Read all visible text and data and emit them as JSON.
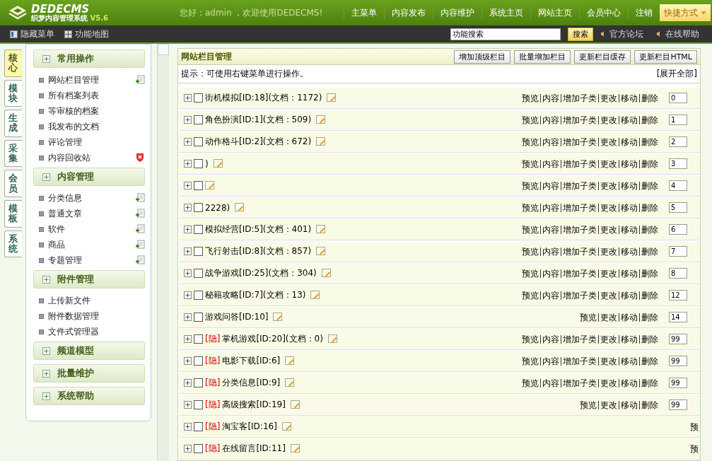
{
  "header": {
    "product": "DEDECMS",
    "subtitle": "织梦内容管理系统",
    "version": "V5.6",
    "greeting": "您好：admin ，欢迎使用DEDECMS!",
    "nav": [
      "主菜单",
      "内容发布",
      "内容维护",
      "系统主页",
      "网站主页",
      "会员中心",
      "注销"
    ],
    "quick": "快捷方式"
  },
  "toolbar": {
    "left": [
      "隐藏菜单",
      "功能地图"
    ],
    "search": {
      "value": "功能搜索"
    },
    "search_button": "搜索",
    "links": [
      "官方论坛",
      "在线帮助"
    ]
  },
  "side_tabs": [
    {
      "label": "核心",
      "selected": true
    },
    {
      "label": "模块",
      "selected": false
    },
    {
      "label": "生成",
      "selected": false
    },
    {
      "label": "采集",
      "selected": false
    },
    {
      "label": "会员",
      "selected": false
    },
    {
      "label": "模板",
      "selected": false
    },
    {
      "label": "系统",
      "selected": false
    }
  ],
  "sidebar": [
    {
      "title": "常用操作",
      "items": [
        {
          "label": "网站栏目管理",
          "kind": "add"
        },
        {
          "label": "所有档案列表",
          "kind": "plain"
        },
        {
          "label": "等审核的档案",
          "kind": "plain"
        },
        {
          "label": "我发布的文档",
          "kind": "plain"
        },
        {
          "label": "评论管理",
          "kind": "plain"
        },
        {
          "label": "内容回收站",
          "kind": "delete"
        }
      ]
    },
    {
      "title": "内容管理",
      "items": [
        {
          "label": "分类信息",
          "kind": "add"
        },
        {
          "label": "普通文章",
          "kind": "add"
        },
        {
          "label": "软件",
          "kind": "add"
        },
        {
          "label": "商品",
          "kind": "add"
        },
        {
          "label": "专题管理",
          "kind": "add"
        }
      ]
    },
    {
      "title": "附件管理",
      "items": [
        {
          "label": "上传新文件",
          "kind": "plain"
        },
        {
          "label": "附件数据管理",
          "kind": "plain"
        },
        {
          "label": "文件式管理器",
          "kind": "plain"
        }
      ]
    },
    {
      "title": "频道模型"
    },
    {
      "title": "批量维护"
    },
    {
      "title": "系统帮助"
    }
  ],
  "panel": {
    "title": "网站栏目管理",
    "buttons": [
      "增加顶级栏目",
      "批量增加栏目",
      "更新栏目缓存",
      "更新栏目HTML"
    ],
    "tip": "提示：可使用右键菜单进行操作。",
    "expand_all": "[展开全部]",
    "rows": [
      {
        "checked": false,
        "name": "街机模拟[ID:18](文档：1172)",
        "actions": [
          "预览",
          "内容",
          "增加子类",
          "更改",
          "移动",
          "删除"
        ],
        "order": "0"
      },
      {
        "checked": false,
        "name": "角色扮演[ID:1](文档：509)",
        "actions": [
          "预览",
          "内容",
          "增加子类",
          "更改",
          "移动",
          "删除"
        ],
        "order": "1"
      },
      {
        "checked": false,
        "name": "动作格斗[ID:2](文档：672)",
        "actions": [
          "预览",
          "内容",
          "增加子类",
          "更改",
          "移动",
          "删除"
        ],
        "order": "2"
      },
      {
        "checked": false,
        "name": ")",
        "actions": [
          "预览",
          "内容",
          "增加子类",
          "更改",
          "移动",
          "删除"
        ],
        "order": "3"
      },
      {
        "checked": false,
        "actions": [
          "预览",
          "内容",
          "增加子类",
          "更改",
          "移动",
          "删除"
        ],
        "order": "4"
      },
      {
        "checked": false,
        "name": "2228)",
        "actions": [
          "预览",
          "内容",
          "增加子类",
          "更改",
          "移动",
          "删除"
        ],
        "order": "5"
      },
      {
        "checked": false,
        "name": "模拟经营[ID:5](文档：401)",
        "actions": [
          "预览",
          "内容",
          "增加子类",
          "更改",
          "移动",
          "删除"
        ],
        "order": "6"
      },
      {
        "checked": false,
        "name": "飞行射击[ID:8](文档：857)",
        "actions": [
          "预览",
          "内容",
          "增加子类",
          "更改",
          "移动",
          "删除"
        ],
        "order": "7"
      },
      {
        "checked": false,
        "name": "战争游戏[ID:25](文档：304)",
        "actions": [
          "预览",
          "内容",
          "增加子类",
          "更改",
          "移动",
          "删除"
        ],
        "order": "8"
      },
      {
        "checked": false,
        "name": "秘籍攻略[ID:7](文档：13)",
        "actions": [
          "预览",
          "内容",
          "增加子类",
          "更改",
          "移动",
          "删除"
        ],
        "order": "12"
      },
      {
        "checked": false,
        "name": "游戏问答[ID:10]",
        "actions": [
          "预览",
          "更改",
          "移动",
          "删除"
        ],
        "order": "14"
      },
      {
        "checked": false,
        "tag": "[隐]",
        "name": "掌机游戏[ID:20](文档：0)",
        "actions": [
          "预览",
          "内容",
          "增加子类",
          "更改",
          "移动",
          "删除"
        ],
        "order": "99"
      },
      {
        "checked": false,
        "tag": "[隐]",
        "name": "电影下载[ID:6]",
        "actions": [
          "预览",
          "内容",
          "增加子类",
          "更改",
          "移动",
          "删除"
        ],
        "order": "99"
      },
      {
        "checked": false,
        "tag": "[隐]",
        "name": "分类信息[ID:9]",
        "actions": [
          "预览",
          "内容",
          "增加子类",
          "更改",
          "移动",
          "删除"
        ],
        "order": "99"
      },
      {
        "checked": false,
        "tag": "[隐]",
        "name": "高级搜索[ID:19]",
        "actions": [
          "预览",
          "更改",
          "移动",
          "删除"
        ],
        "order": "99"
      },
      {
        "checked": false,
        "tag": "[隐]",
        "name": "淘宝客[ID:16]",
        "actions": [
          "预"
        ]
      },
      {
        "checked": false,
        "tag": "[隐]",
        "name": "在线留言[ID:11]",
        "actions": [
          "预"
        ]
      }
    ]
  }
}
